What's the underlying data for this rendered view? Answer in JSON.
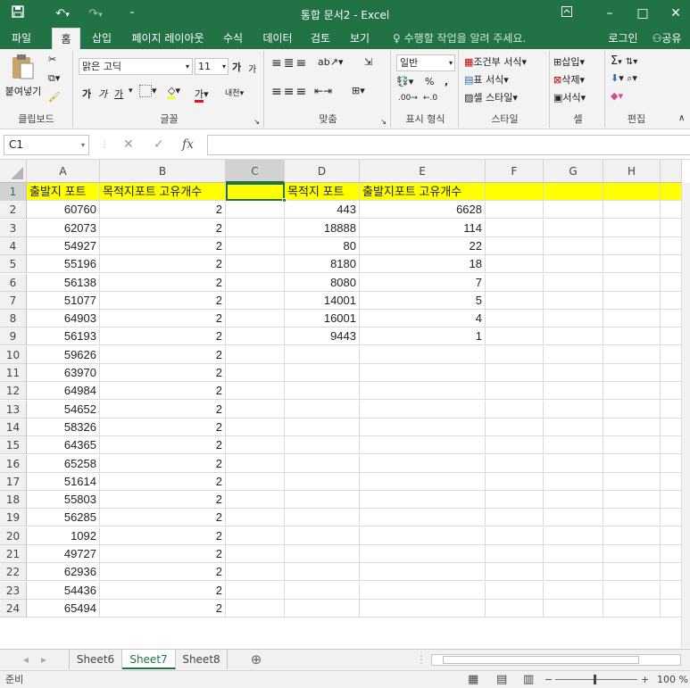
{
  "app": {
    "window_title": "통합 문서2 - Excel",
    "accent_color": "#217346",
    "header_fill_color": "#ffff00"
  },
  "quick_access": {
    "save_icon": "save-icon",
    "undo_icon": "undo-icon",
    "redo_icon": "redo-icon",
    "customize_icon": "customize-icon"
  },
  "window_controls": {
    "ribbon_display_icon": "ribbon-display-icon",
    "minimize": "–",
    "maximize": "□",
    "close": "✕"
  },
  "ribbon_tabs": [
    "파일",
    "홈",
    "삽입",
    "페이지 레이아웃",
    "수식",
    "데이터",
    "검토",
    "보기"
  ],
  "active_tab": "홈",
  "tell_me": "수행할 작업을 알려 주세요.",
  "account": {
    "sign_in": "로그인",
    "share": "공유"
  },
  "ribbon": {
    "clipboard": {
      "label": "클립보드",
      "paste": "붙여넣기"
    },
    "font": {
      "label": "글꼴",
      "font_name": "맑은 고딕",
      "font_size": "11",
      "grow": "가",
      "shrink": "가",
      "bold": "가",
      "italic": "가",
      "underline": "가",
      "font_color": "가",
      "phonetic": "내천"
    },
    "alignment": {
      "label": "맞춤"
    },
    "number": {
      "label": "표시 형식",
      "format": "일반",
      "percent": "%",
      "comma": ","
    },
    "styles": {
      "label": "스타일",
      "conditional": "조건부 서식",
      "table": "표 서식",
      "cell_styles": "셀 스타일"
    },
    "cells": {
      "label": "셀",
      "insert": "삽입",
      "delete": "삭제",
      "format": "서식"
    },
    "editing": {
      "label": "편집",
      "sum": "Σ"
    }
  },
  "formula_bar": {
    "name_box": "C1",
    "fx": "fx",
    "cancel": "✕",
    "enter": "✓",
    "formula": ""
  },
  "columns": [
    "A",
    "B",
    "C",
    "D",
    "E",
    "F",
    "G",
    "H"
  ],
  "selected_column": "C",
  "selected_row": 1,
  "header_row": {
    "A": "출발지 포트",
    "B": "목적지포트 고유개수",
    "C": "",
    "D": "목적지 포트",
    "E": "출발지포트 고유개수"
  },
  "rows": [
    {
      "n": 2,
      "A": "60760",
      "B": "2",
      "D": "443",
      "E": "6628"
    },
    {
      "n": 3,
      "A": "62073",
      "B": "2",
      "D": "18888",
      "E": "114"
    },
    {
      "n": 4,
      "A": "54927",
      "B": "2",
      "D": "80",
      "E": "22"
    },
    {
      "n": 5,
      "A": "55196",
      "B": "2",
      "D": "8180",
      "E": "18"
    },
    {
      "n": 6,
      "A": "56138",
      "B": "2",
      "D": "8080",
      "E": "7"
    },
    {
      "n": 7,
      "A": "51077",
      "B": "2",
      "D": "14001",
      "E": "5"
    },
    {
      "n": 8,
      "A": "64903",
      "B": "2",
      "D": "16001",
      "E": "4"
    },
    {
      "n": 9,
      "A": "56193",
      "B": "2",
      "D": "9443",
      "E": "1"
    },
    {
      "n": 10,
      "A": "59626",
      "B": "2",
      "D": "",
      "E": ""
    },
    {
      "n": 11,
      "A": "63970",
      "B": "2",
      "D": "",
      "E": ""
    },
    {
      "n": 12,
      "A": "64984",
      "B": "2",
      "D": "",
      "E": ""
    },
    {
      "n": 13,
      "A": "54652",
      "B": "2",
      "D": "",
      "E": ""
    },
    {
      "n": 14,
      "A": "58326",
      "B": "2",
      "D": "",
      "E": ""
    },
    {
      "n": 15,
      "A": "64365",
      "B": "2",
      "D": "",
      "E": ""
    },
    {
      "n": 16,
      "A": "65258",
      "B": "2",
      "D": "",
      "E": ""
    },
    {
      "n": 17,
      "A": "51614",
      "B": "2",
      "D": "",
      "E": ""
    },
    {
      "n": 18,
      "A": "55803",
      "B": "2",
      "D": "",
      "E": ""
    },
    {
      "n": 19,
      "A": "56285",
      "B": "2",
      "D": "",
      "E": ""
    },
    {
      "n": 20,
      "A": "1092",
      "B": "2",
      "D": "",
      "E": ""
    },
    {
      "n": 21,
      "A": "49727",
      "B": "2",
      "D": "",
      "E": ""
    },
    {
      "n": 22,
      "A": "62936",
      "B": "2",
      "D": "",
      "E": ""
    },
    {
      "n": 23,
      "A": "54436",
      "B": "2",
      "D": "",
      "E": ""
    },
    {
      "n": 24,
      "A": "65494",
      "B": "2",
      "D": "",
      "E": ""
    }
  ],
  "sheets": [
    "Sheet6",
    "Sheet7",
    "Sheet8"
  ],
  "active_sheet": "Sheet7",
  "status": {
    "mode": "준비",
    "zoom": "100 %"
  }
}
